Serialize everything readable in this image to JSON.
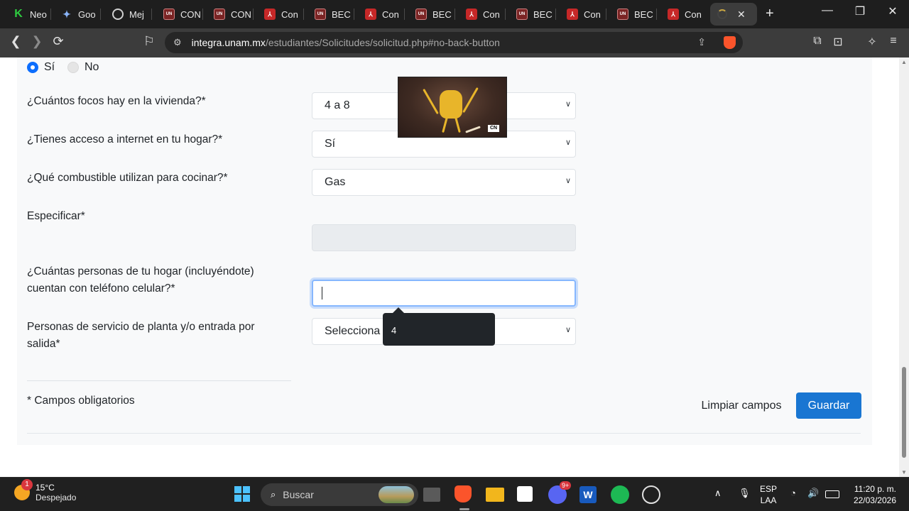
{
  "browser": {
    "tabs": [
      {
        "label": "Neo",
        "icon": "k-icon"
      },
      {
        "label": "Goo",
        "icon": "gemini-icon"
      },
      {
        "label": "Mej",
        "icon": "record-icon"
      },
      {
        "label": "CON",
        "icon": "unam-icon"
      },
      {
        "label": "CON",
        "icon": "unam-icon"
      },
      {
        "label": "Con",
        "icon": "pdf-icon"
      },
      {
        "label": "BEC",
        "icon": "unam-icon"
      },
      {
        "label": "Con",
        "icon": "pdf-icon"
      },
      {
        "label": "BEC",
        "icon": "unam-icon"
      },
      {
        "label": "Con",
        "icon": "pdf-icon"
      },
      {
        "label": "BEC",
        "icon": "unam-icon"
      },
      {
        "label": "Con",
        "icon": "pdf-icon"
      },
      {
        "label": "BEC",
        "icon": "unam-icon"
      },
      {
        "label": "Con",
        "icon": "pdf-icon"
      }
    ],
    "url_host": "integra.unam.mx",
    "url_path": "/estudiantes/Solicitudes/solicitud.php#no-back-button"
  },
  "form": {
    "radio_yes": "Sí",
    "radio_no": "No",
    "q_focos": "¿Cuántos focos hay en la vivienda?*",
    "v_focos": "4 a 8",
    "q_internet": "¿Tienes acceso a internet en tu hogar?*",
    "v_internet": "Sí",
    "q_combustible": "¿Qué combustible utilizan para cocinar?*",
    "v_combustible": "Gas",
    "q_especificar": "Especificar*",
    "q_celular": "¿Cuántas personas de tu hogar (incluyéndote) cuentan con teléfono celular?*",
    "q_servicio": "Personas de servicio de planta y/o entrada por salida*",
    "v_servicio": "Selecciona",
    "tooltip": "4",
    "required_note": "* Campos obligatorios",
    "clear_label": "Limpiar campos",
    "save_label": "Guardar"
  },
  "taskbar": {
    "weather_temp": "15°C",
    "weather_desc": "Despejado",
    "weather_badge": "1",
    "search_label": "Buscar",
    "discord_badge": "9+",
    "lang_1": "ESP",
    "lang_2": "LAA",
    "time": "11:20 p. m.",
    "date": "22/03/2026"
  },
  "colors": {
    "primary_button": "#1976d2",
    "radio_selected": "#0d6efd",
    "focus_ring": "#86b7fe"
  }
}
